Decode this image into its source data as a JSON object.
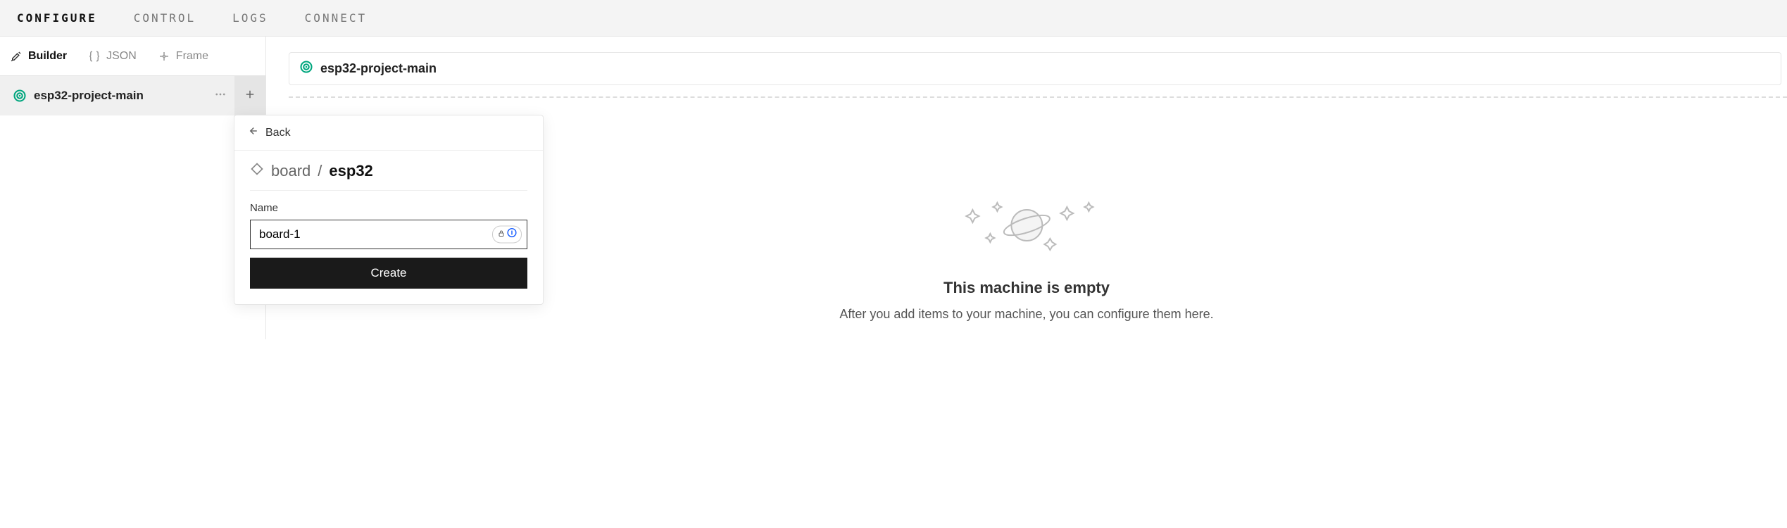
{
  "topnav": {
    "tabs": [
      "CONFIGURE",
      "CONTROL",
      "LOGS",
      "CONNECT"
    ],
    "active": 0
  },
  "subtabs": {
    "items": [
      "Builder",
      "JSON",
      "Frame"
    ],
    "active": 0
  },
  "project": {
    "name": "esp32-project-main"
  },
  "breadcrumb": {
    "name": "esp32-project-main"
  },
  "empty": {
    "title": "This machine is empty",
    "desc": "After you add items to your machine, you can configure them here."
  },
  "popover": {
    "back_label": "Back",
    "crumb_type": "board",
    "crumb_slash": " / ",
    "crumb_model": "esp32",
    "name_label": "Name",
    "name_value": "board-1",
    "create_label": "Create"
  },
  "icons": {
    "viam_color": "#00a67e"
  }
}
